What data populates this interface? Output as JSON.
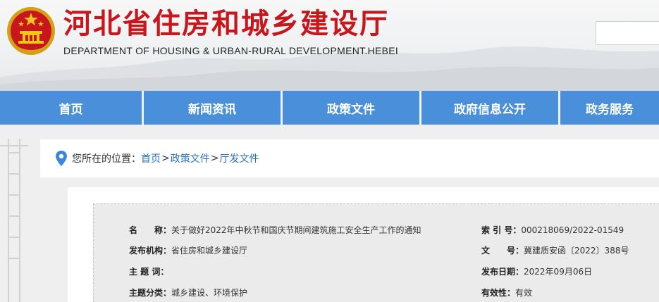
{
  "header": {
    "title": "河北省住房和城乡建设厅",
    "subtitle": "DEPARTMENT OF HOUSING & URBAN-RURAL DEVELOPMENT.HEBEI",
    "search_placeholder": ""
  },
  "nav": {
    "items": [
      {
        "label": "首页"
      },
      {
        "label": "新闻资讯"
      },
      {
        "label": "政策文件"
      },
      {
        "label": "政府信息公开"
      },
      {
        "label": "政务服务"
      }
    ]
  },
  "breadcrumb": {
    "prefix": "您所在的位置：",
    "items": [
      "首页",
      "政策文件",
      "厅发文件"
    ],
    "separator": ">"
  },
  "document_meta": {
    "name_label": "名　　称：",
    "name_value": "关于做好2022年中秋节和国庆节期间建筑施工安全生产工作的通知",
    "index_label": "索 引 号：",
    "index_value": "000218069/2022-01549",
    "publisher_label": "发布机构：",
    "publisher_value": "省住房和城乡建设厅",
    "doc_no_label": "文　　号：",
    "doc_no_value": "冀建质安函〔2022〕388号",
    "keywords_label": "主 题 词：",
    "keywords_value": "",
    "date_label": "发布日期：",
    "date_value": "2022年09月06日",
    "category_label": "主题分类：",
    "category_value": "城乡建设、环境保护",
    "validity_label": "有效性：",
    "validity_value": "有效"
  },
  "colors": {
    "title_red": "#c8161d",
    "nav_blue": "#4a8fd9",
    "link_blue": "#2c6fbf"
  },
  "icons": [
    "national-emblem-icon",
    "location-pin-icon"
  ]
}
